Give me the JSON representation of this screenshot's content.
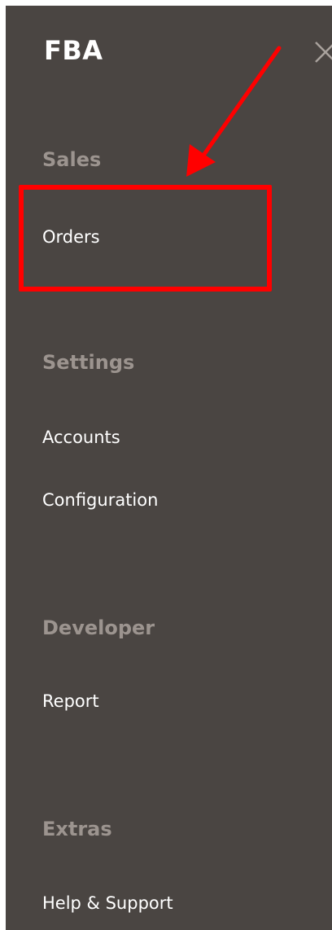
{
  "header": {
    "title": "FBA",
    "close_icon": "close-icon"
  },
  "sections": [
    {
      "heading": "Sales",
      "items": [
        "Orders"
      ]
    },
    {
      "heading": "Settings",
      "items": [
        "Accounts",
        "Configuration"
      ]
    },
    {
      "heading": "Developer",
      "items": [
        "Report"
      ]
    },
    {
      "heading": "Extras",
      "items": [
        "Help & Support"
      ]
    }
  ],
  "annotation": {
    "highlighted_item": "Orders",
    "color": "#ff0000"
  },
  "colors": {
    "panel_background": "#4a4542",
    "heading_text": "#9c948f",
    "item_text": "#ffffff"
  }
}
